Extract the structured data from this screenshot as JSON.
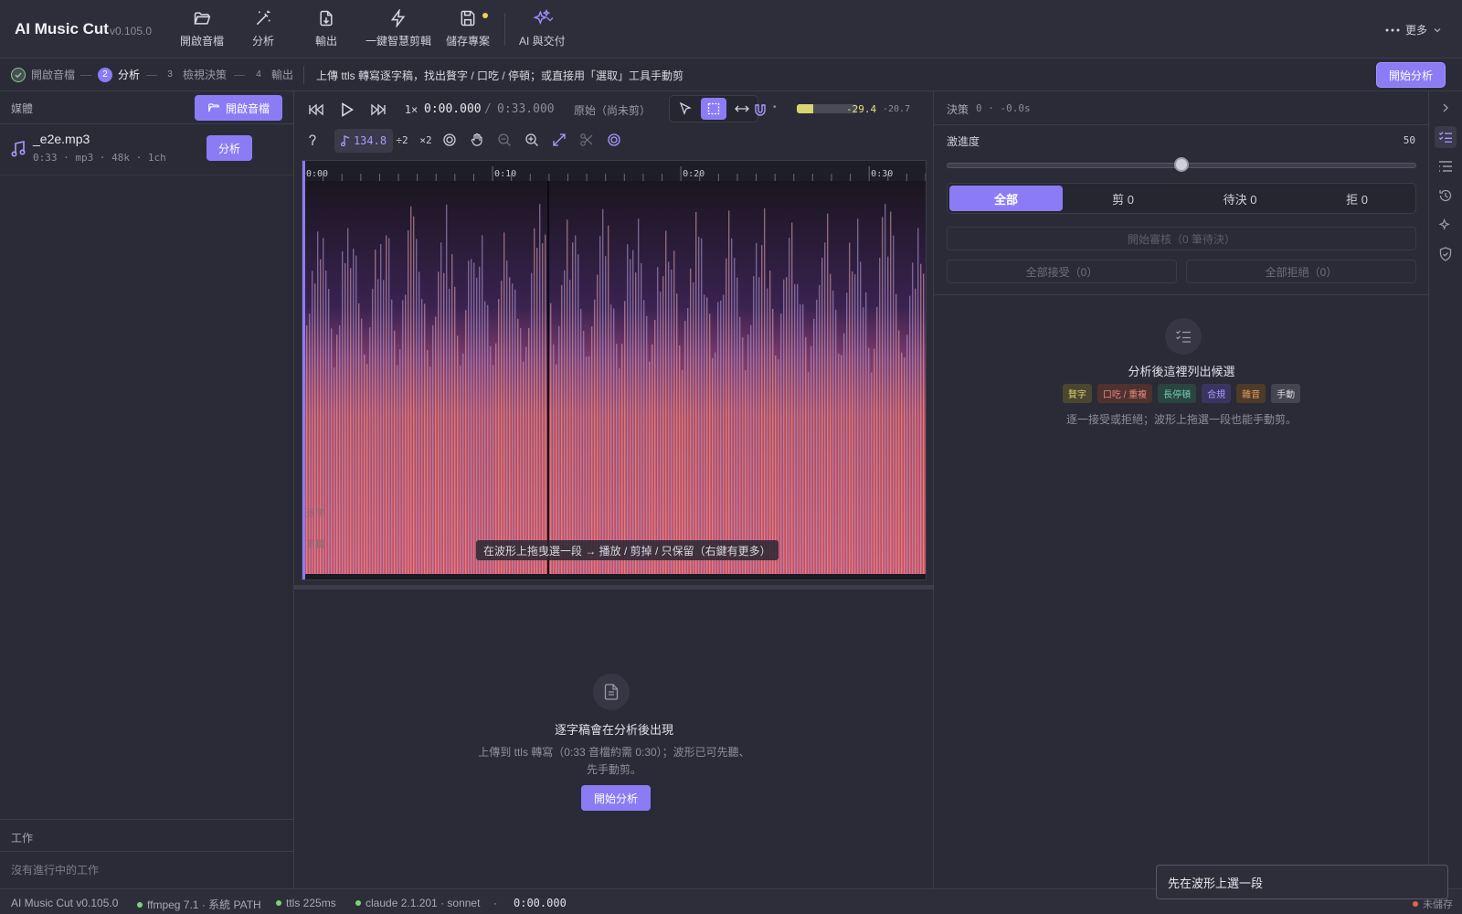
{
  "app": {
    "title": "AI Music Cut",
    "version": "v0.105.0"
  },
  "toolbar": {
    "open_label": "開啟音檔",
    "analyze_label": "分析",
    "export_label": "輸出",
    "smart_cut_label": "一鍵智慧剪輯",
    "save_label": "儲存專案",
    "ai_deliver_label": "AI 與交付",
    "more_label": "更多"
  },
  "steps": {
    "s1": "開啟音檔",
    "s2_num": "2",
    "s2": "分析",
    "s3_num": "3",
    "s3": "檢視決策",
    "s4_num": "4",
    "s4": "輸出",
    "hint": "上傳 ttls 轉寫逐字稿，找出贅字 / 口吃 / 停頓；或直接用「選取」工具手動剪",
    "start_label": "開始分析"
  },
  "media": {
    "title": "媒體",
    "open_label": "開啟音檔",
    "file_name": "_e2e.mp3",
    "file_meta": "0:33 · mp3 · 48k · 1ch",
    "analyze_label": "分析"
  },
  "jobs": {
    "title": "工作",
    "empty": "沒有進行中的工作"
  },
  "transport": {
    "speed": "1×",
    "position": "0:00.000",
    "separator": "/",
    "duration": "0:33.000",
    "mode": "原始（尚未剪）",
    "level_db": "-29.4",
    "peak_db": "-20.7",
    "level_fraction": 0.28,
    "bpm": "134.8",
    "div2": "÷2",
    "mul2": "×2"
  },
  "timeline": {
    "ticks": [
      "0:00",
      "0:10",
      "0:20",
      "0:30"
    ],
    "lane_labels": [
      "逐字",
      "剪輯"
    ],
    "hint": "在波形上拖曳選一段 → 播放 / 剪掉 / 只保留（右鍵有更多）"
  },
  "transcript": {
    "title": "逐字稿會在分析後出現",
    "sub1": "上傳到 ttls 轉寫（0:33 音檔約需 0:30）；波形已可先聽、",
    "sub2": "先手動剪。",
    "start_label": "開始分析"
  },
  "decisions": {
    "title": "決策",
    "stats": "0 · -0.0s",
    "aggressiveness_label": "激進度",
    "aggressiveness_value": "50",
    "aggressiveness_fraction": 0.5,
    "tabs": [
      "全部",
      "剪 0",
      "待決 0",
      "拒 0"
    ],
    "review_label": "開始審核（0 筆待決）",
    "accept_all": "全部接受（0）",
    "reject_all": "全部拒絕（0）",
    "empty_title": "分析後這裡列出候選",
    "tags": [
      {
        "label": "贅字",
        "color": "#d8c96a",
        "bg": "#4a4630"
      },
      {
        "label": "口吃 / 重複",
        "color": "#e98a7a",
        "bg": "#4e3230"
      },
      {
        "label": "長停頓",
        "color": "#6fd0b0",
        "bg": "#2a4440"
      },
      {
        "label": "合規",
        "color": "#a99bff",
        "bg": "#3a3560"
      },
      {
        "label": "雜音",
        "color": "#e8a060",
        "bg": "#4c3a2a"
      },
      {
        "label": "手動",
        "color": "#d8d8e2",
        "bg": "#45454f"
      }
    ],
    "empty_sub": "逐一接受或拒絕；波形上拖選一段也能手動剪。"
  },
  "status": {
    "app": "AI Music Cut v0.105.0",
    "ffmpeg": "ffmpeg 7.1 · 系統 PATH",
    "ttls": "ttls 225ms",
    "claude": "claude 2.1.201 · sonnet",
    "sep": "·",
    "time": "0:00.000",
    "unsaved": "未儲存"
  },
  "toast": {
    "text": "先在波形上選一段"
  },
  "colors": {
    "accent": "#8b7cf6",
    "ok": "#7ed37a",
    "warn": "#f0d060",
    "error": "#e8604a"
  }
}
